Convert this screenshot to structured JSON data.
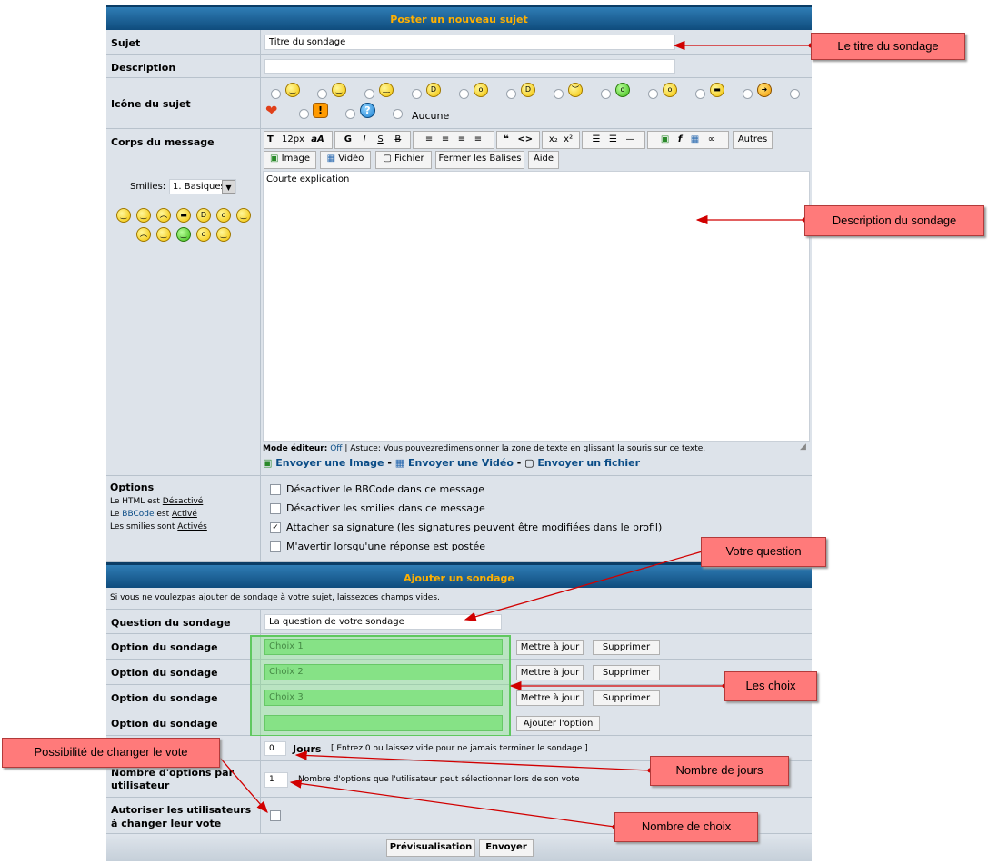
{
  "header_new_topic": "Poster un nouveau sujet",
  "subject": {
    "label": "Sujet",
    "value": "Titre du sondage"
  },
  "description": {
    "label": "Description",
    "value": ""
  },
  "topic_icon": {
    "label": "Icône du sujet",
    "none_label": "Aucune"
  },
  "body": {
    "label": "Corps du message",
    "smilies_label": "Smilies:",
    "smilies_select": "1. Basiques",
    "font_size": "12px",
    "others_btn": "Autres",
    "btn_image": "Image",
    "btn_video": "Vidéo",
    "btn_file": "Fichier",
    "btn_close_tags": "Fermer les Balises",
    "btn_help": "Aide",
    "text": "Courte explication",
    "editor_mode_label": "Mode éditeur:",
    "editor_mode_value": "Off",
    "tip": "| Astuce: Vous pouvezredimensionner la zone de texte en glissant la souris sur ce texte.",
    "send_image": "Envoyer une Image",
    "send_video": "Envoyer une Vidéo",
    "send_file": "Envoyer un fichier",
    "sep": "-"
  },
  "options": {
    "title": "Options",
    "html_prefix": "Le HTML est",
    "html_state": "Désactivé",
    "bbcode_prefix": "Le",
    "bbcode_word": "BBCode",
    "bbcode_mid": "est",
    "bbcode_state": "Activé",
    "smilies_prefix": "Les smilies sont",
    "smilies_state": "Activés",
    "opt1": "Désactiver le BBCode dans ce message",
    "opt2": "Désactiver les smilies dans ce message",
    "opt3": "Attacher sa signature (les signatures peuvent être modifiées dans le profil)",
    "opt4": "M'avertir lorsqu'une réponse est postée"
  },
  "poll": {
    "header": "Ajouter un sondage",
    "info": "Si vous ne voulezpas ajouter de sondage à votre sujet, laissezces champs vides.",
    "question_label": "Question du sondage",
    "question_value": "La question de votre sondage",
    "option_label": "Option du sondage",
    "options": [
      "Choix 1",
      "Choix 2",
      "Choix 3"
    ],
    "update_btn": "Mettre à jour",
    "delete_btn": "Supprimer",
    "add_btn": "Ajouter l'option",
    "days_value": "0",
    "days_label": "Jours",
    "days_hint": "[ Entrez 0 ou laissez vide pour ne jamais terminer le sondage ]",
    "max_options_label": "Nombre d'options par utilisateur",
    "max_options_value": "1",
    "max_options_hint": "Nombre d'options que l'utilisateur peut sélectionner lors de son vote",
    "allow_change_label": "Autoriser les utilisateurs à changer leur vote"
  },
  "buttons": {
    "preview": "Prévisualisation",
    "send": "Envoyer"
  },
  "annotations": {
    "titre": "Le titre du sondage",
    "description": "Description du sondage",
    "question": "Votre question",
    "choix": "Les choix",
    "jours": "Nombre de jours",
    "changer": "Possibilité de changer le vote",
    "nombre": "Nombre de choix"
  }
}
